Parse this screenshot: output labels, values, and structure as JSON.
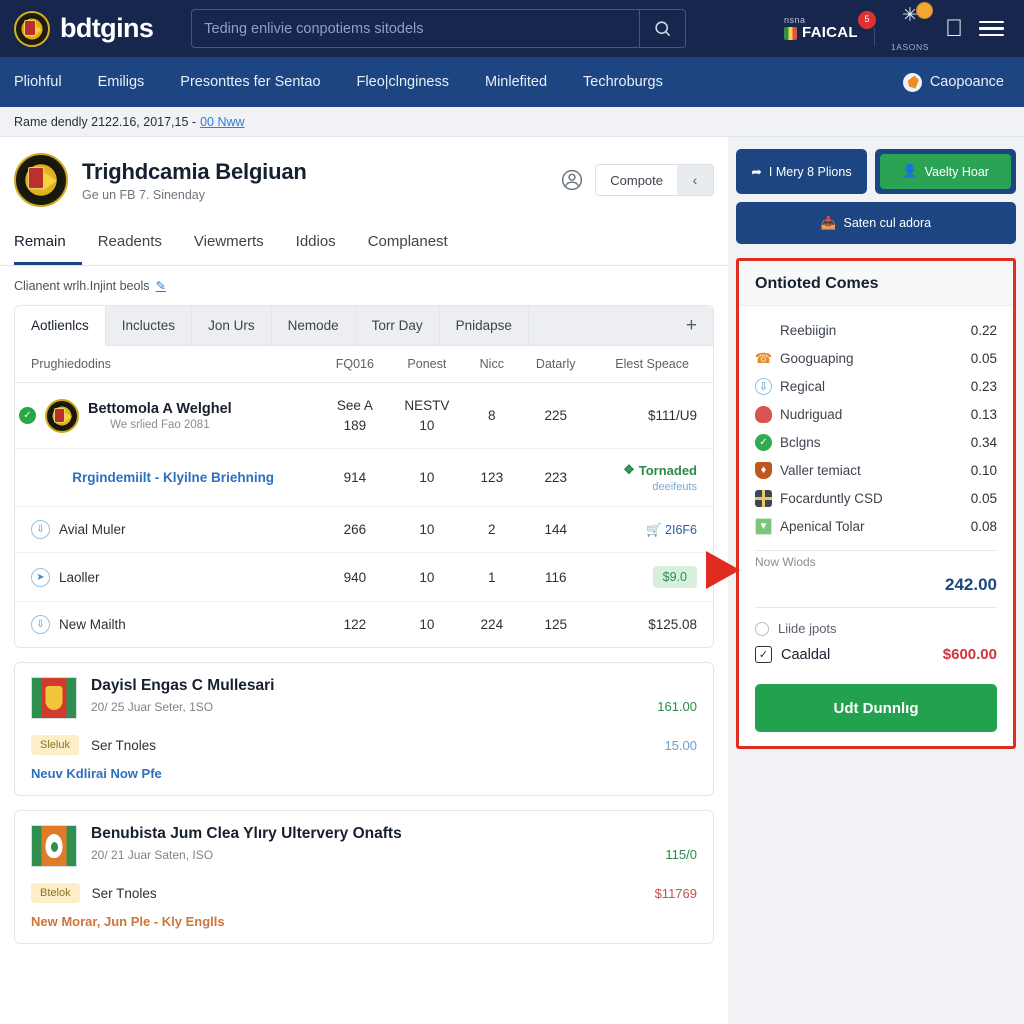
{
  "header": {
    "brand": "bdtgins",
    "brand_logo_icon": "crest-logo-icon",
    "search_placeholder": "Teding enlivie conpotiems sitodels",
    "search_value": "",
    "search_icon": "search-icon",
    "account_small": "nsna",
    "account_big": "FAICAL",
    "notif_count": "5",
    "coin_label": "1ASONS",
    "sparkle_icon": "sparkle-icon",
    "apple_icon": "apple-icon",
    "menu_icon": "hamburger-menu-icon"
  },
  "nav": {
    "items": [
      "Pliohful",
      "Emiligs",
      "Presonttes fer Sentao",
      "Fleo|clnginess",
      "Minlefited",
      "Techroburgs"
    ],
    "right_label": "Caopoance",
    "right_icon": "globe-icon"
  },
  "breadcrumb": {
    "text": "Rame dendly 2122.16, 2017,15 -",
    "link": "00 Nww"
  },
  "profile": {
    "title": "Trighdcamia Belgiuan",
    "subtitle": "Ge un FB 7. Sinenday",
    "person_icon": "person-circle-icon",
    "segment_label": "Compote",
    "segment_icon": "chevron-left-icon"
  },
  "tabs": [
    {
      "label": "Remain",
      "active": true
    },
    {
      "label": "Readents",
      "active": false
    },
    {
      "label": "Viewmerts",
      "active": false
    },
    {
      "label": "Iddios",
      "active": false
    },
    {
      "label": "Complanest",
      "active": false
    }
  ],
  "note": {
    "text": "Clianent wrlh.Injint beols",
    "icon": "pen-underline-icon"
  },
  "panel": {
    "tabs": [
      {
        "label": "Aotlienlcs",
        "active": true
      },
      {
        "label": "Incluctes",
        "active": false
      },
      {
        "label": "Jon Urs",
        "active": false
      },
      {
        "label": "Nemode",
        "active": false
      },
      {
        "label": "Torr Day",
        "active": false
      },
      {
        "label": "Pnidapse",
        "active": false
      }
    ],
    "add_icon": "plus-icon",
    "columns": [
      "Prughiedodins",
      "FQ016",
      "Ponest",
      "Nicc",
      "Datarly",
      "Elest Speace"
    ],
    "rows": [
      {
        "kind": "main",
        "check_icon": "check-circle-icon",
        "avatar_icon": "crest-avatar-icon",
        "name": "Bettomola A Welghel",
        "sub": "We srlied Fao 2081",
        "c1_top": "See A",
        "c1_bot": "189",
        "c2_top": "NESTV",
        "c2_bot": "10",
        "c3": "8",
        "c4": "225",
        "c5": "$111/U9",
        "c5_style": "price-red"
      },
      {
        "kind": "link",
        "name": "Rrgindemiilt - Klyilne Briehning",
        "c1_top": "914",
        "c1_bot": "",
        "c2_top": "10",
        "c2_bot": "",
        "c3": "123",
        "c4": "223",
        "c5": "Tornaded",
        "c5_sub": "deeifeuts",
        "c5_style": "tag-green",
        "c5_icon": "leaf-icon"
      },
      {
        "kind": "item",
        "row_icon": "info-circle-icon",
        "name": "Avial Muler",
        "c1_top": "266",
        "c1_bot": "",
        "c2_top": "10",
        "c2_bot": "",
        "c3": "2",
        "c4": "144",
        "c5": "2I6F6",
        "c5_style": "blue-small",
        "c5_icon": "cart-icon"
      },
      {
        "kind": "item",
        "row_icon": "compass-circle-icon",
        "name": "Laoller",
        "c1_top": "940",
        "c1_bot": "",
        "c2_top": "10",
        "c2_bot": "",
        "c3": "1",
        "c4": "116",
        "c5": "$9.0",
        "c5_style": "pill-green"
      },
      {
        "kind": "item",
        "row_icon": "info-circle-icon",
        "name": "New Mailth",
        "c1_top": "122",
        "c1_bot": "",
        "c2_top": "10",
        "c2_bot": "",
        "c3": "224",
        "c4": "125",
        "c5": "$125.08",
        "c5_style": "price-orange"
      }
    ]
  },
  "offers": [
    {
      "flag_icon": "flag-red-icon",
      "name": "Dayisl Engas C Mullesari",
      "sub": "20/ 25 Juar Seter, 1SO",
      "amount": "161.00",
      "badge": "Sleluk",
      "row2_label": "Ser Tnoles",
      "row2_amount": "15.00",
      "footer": "Neuv Kdlirai Now Pfe",
      "footer_style": "blue"
    },
    {
      "flag_icon": "flag-orange-icon",
      "name": "Benubista Jum Clea Ylıry Ultervery Onafts",
      "sub": "20/ 21 Juar Saten, ISO",
      "amount": "115/0",
      "badge": "Btelok",
      "row2_label": "Ser Tnoles",
      "row2_amount": "$11769",
      "footer": "New Morar, Jun Ple - Kly Englls",
      "footer_style": "orange"
    }
  ],
  "sidebar": {
    "btn1": {
      "label": "I Mery 8 Plions",
      "icon": "share-icon"
    },
    "btn2": {
      "label": "Vaelty Hoar",
      "icon": "user-icon"
    },
    "btn3": {
      "label": "Saten cul adora",
      "icon": "download-icon"
    },
    "summary": {
      "title": "Ontioted Comes",
      "lines": [
        {
          "label": "Reebiigin",
          "value": "0.22",
          "icon": "none"
        },
        {
          "label": "Googuaping",
          "value": "0.05",
          "icon": "phone-icon"
        },
        {
          "label": "Regical",
          "value": "0.23",
          "icon": "clock-icon"
        },
        {
          "label": "Nudriguad",
          "value": "0.13",
          "icon": "red-cap-icon"
        },
        {
          "label": "Bclgns",
          "value": "0.34",
          "icon": "check-circle-green-icon"
        },
        {
          "label": "Valler temiact",
          "value": "0.10",
          "icon": "shield-icon"
        },
        {
          "label": "Focarduntly CSD",
          "value": "0.05",
          "icon": "grid-icon"
        },
        {
          "label": "Apenical Tolar",
          "value": "0.08",
          "icon": "envelope-icon"
        }
      ],
      "subtotal_label": "Now Wiods",
      "subtotal_value": "242.00",
      "option_radio_label": "Liide jpots",
      "option_check_label": "Caaldal",
      "option_check_amount": "$600.00",
      "checkbox_icon": "checkbox-checked-icon",
      "radio_icon": "radio-unchecked-icon",
      "cta_label": "Udt Dunnlıg"
    }
  },
  "annotation": {
    "arrow_icon": "red-arrow-right-icon",
    "highlight_color": "#e02b20"
  }
}
